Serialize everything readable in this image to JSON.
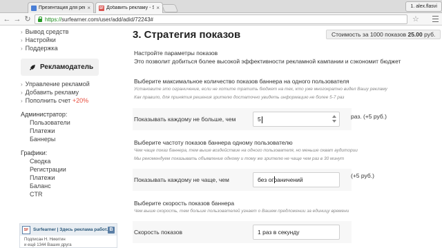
{
  "browser": {
    "tabs": [
      {
        "title": "Презентация для рекламо",
        "favicon_color": "#4a7fd6",
        "active": false
      },
      {
        "title": "Добавить рекламу - Surf",
        "favicon_color": "#d9534f",
        "favicon_text": "SF",
        "active": true
      }
    ],
    "user_button": "1. alex.flasvi",
    "url_scheme": "https://",
    "url_rest": "surfearner.com/user/add/adid/72243#"
  },
  "sidebar": {
    "top_links": [
      "Вывод средств",
      "Настройки",
      "Поддержка"
    ],
    "advertiser_button": "Рекламодатель",
    "adv_links": [
      "Управление рекламой",
      "Добавить рекламу",
      "Пополнить счет"
    ],
    "topup_bonus": "+20%",
    "admin_heading": "Администратор:",
    "admin_links": [
      "Пользователи",
      "Платежи",
      "Баннеры"
    ],
    "graphs_heading": "Графики:",
    "graphs_links": [
      "Сводка",
      "Регистрации",
      "Платежи",
      "Баланс",
      "CTR"
    ],
    "vk_widget": {
      "logo_text": "SF",
      "name": "Surfearner | Здесь реклама работ...",
      "line1": "Подписан Н. Никитин",
      "line2": "и ещё 1344 Ваших друга"
    }
  },
  "main": {
    "title": "3. Стратегия показов",
    "price_badge": {
      "prefix": "Стоимость за 1000 показов",
      "amount": "25.00",
      "suffix": "руб."
    },
    "intro_line1": "Настройте параметры показов",
    "intro_line2": "Это позволит добиться более высокой эффективности рекламной кампании и сэкономит бюджет",
    "s1": {
      "heading": "Выберите максимальное количество показов баннера на одного пользователя",
      "hint1": "Установите это ограничение, если не хотите тратить бюджет на тех, кто уже многократно видел Вашу рекламу",
      "hint2": "Как правило, для принятия решения зрителю достаточно увидеть информацию не более 5-7 раз",
      "label": "Показывать каждому не больше, чем",
      "value": "5",
      "after": "раз. (+5 руб.)"
    },
    "s2": {
      "heading": "Выберите частоту показов баннера одному пользователю",
      "hint1": "Чем чаще показ баннера, тем выше воздействие на одного пользователя, но меньше охват аудитории",
      "hint2": "Мы рекомендуем показывать объявление одному и тому же зрителю не чаще чем раз в 30 минут",
      "label": "Показывать каждому не чаще, чем",
      "value": "без ограничений",
      "after": "(+5 руб.)"
    },
    "s3": {
      "heading": "Выберите скорость показов баннера",
      "hint1": "Чем выше скорость, тем больше пользователей узнает о Вашем предложении за единицу времени",
      "label": "Скорость показов",
      "value": "1 раз в секунду"
    }
  }
}
